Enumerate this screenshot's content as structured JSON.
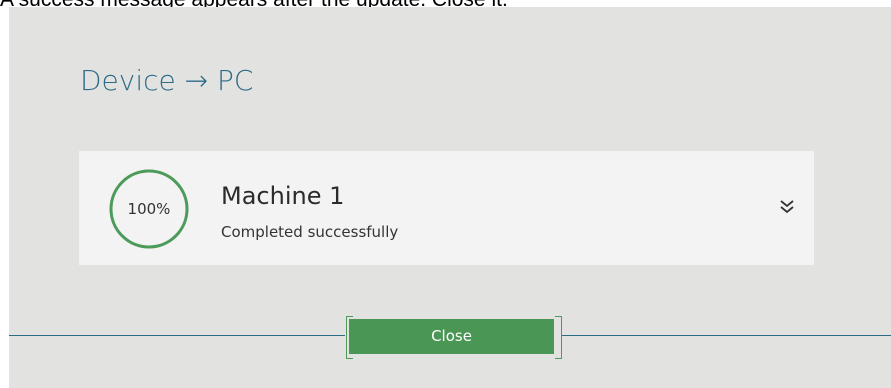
{
  "instruction_caption": "A success message appears after the update. Close it.",
  "dialog": {
    "title": "Device → PC",
    "job": {
      "progress_label": "100%",
      "progress_fraction": 1.0,
      "machine_name": "Machine 1",
      "status": "Completed successfully",
      "expand_icon": "double-chevron-down-icon"
    },
    "close_label": "Close"
  },
  "colors": {
    "panel_background": "#e2e3e1",
    "card_background": "#f3f3f3",
    "title_blue": "#2c6b86",
    "success_green": "#4a9655",
    "ring_green": "#4c9b5a"
  }
}
